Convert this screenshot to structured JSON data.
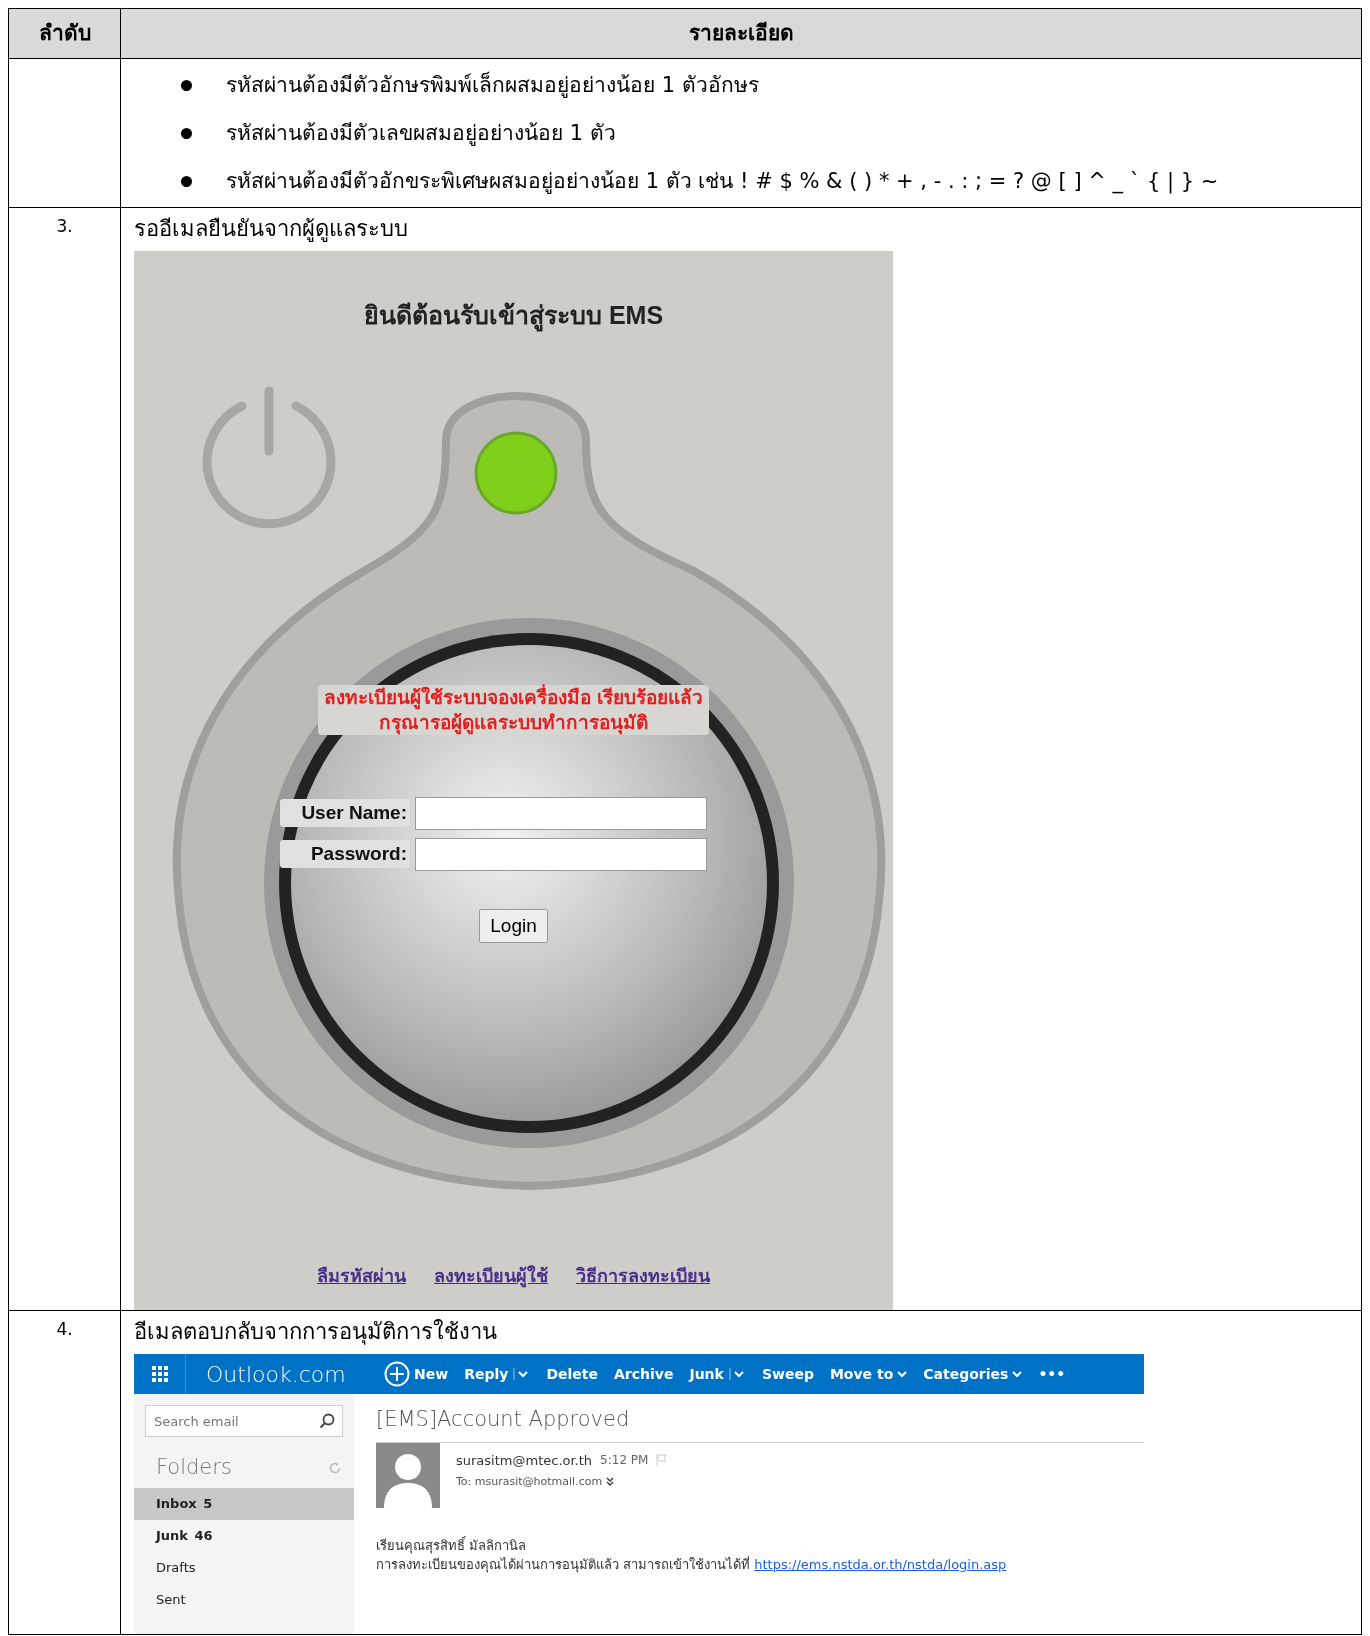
{
  "table": {
    "columns": [
      "ลำดับ",
      "รายละเอียด"
    ],
    "rows": [
      {
        "kind": "bullets",
        "bullets": [
          "รหัสผ่านต้องมีตัวอักษรพิมพ์เล็กผสมอยู่อย่างน้อย 1 ตัวอักษร",
          "รหัสผ่านต้องมีตัวเลขผสมอยู่อย่างน้อย 1 ตัว",
          "รหัสผ่านต้องมีตัวอักขระพิเศษผสมอยู่อย่างน้อย 1 ตัว เช่น ! # $ % & ( ) * + , - . : ; = ? @ [ ] ^ _ ` { | } ~"
        ]
      },
      {
        "kind": "login",
        "number": "3.",
        "title": "รออีเมลยืนยันจากผู้ดูแลระบบ",
        "screen": {
          "heading": "ยินดีต้อนรับเข้าสู่ระบบ EMS",
          "message": [
            "ลงทะเบียนผู้ใช้ระบบจองเครื่องมือ เรียบร้อยแล้ว",
            "กรุณารอผู้ดูแลระบบทำการอนุมัติ"
          ],
          "fields": [
            {
              "label": "User Name:"
            },
            {
              "label": "Password:"
            }
          ],
          "button": "Login",
          "links": [
            "ลืมรหัสผ่าน",
            "ลงทะเบียนผู้ใช้",
            "วิธีการลงทะเบียน"
          ]
        }
      },
      {
        "kind": "email",
        "number": "4.",
        "title": "อีเมลตอบกลับจากการอนุมัติการใช้งาน",
        "screen": {
          "app_name": "Outlook.com",
          "toolbar": [
            {
              "label": "New",
              "kind": "new"
            },
            {
              "label": "Reply",
              "kind": "split"
            },
            {
              "label": "Delete",
              "kind": "plain"
            },
            {
              "label": "Archive",
              "kind": "plain"
            },
            {
              "label": "Junk",
              "kind": "split"
            },
            {
              "label": "Sweep",
              "kind": "plain"
            },
            {
              "label": "Move to",
              "kind": "menu"
            },
            {
              "label": "Categories",
              "kind": "menu"
            },
            {
              "label": "•••",
              "kind": "plain"
            }
          ],
          "search": {
            "placeholder": "Search email"
          },
          "folders_heading": "Folders",
          "folders": [
            {
              "name": "Inbox",
              "count": "5",
              "selected": true
            },
            {
              "name": "Junk",
              "count": "46",
              "selected": false
            },
            {
              "name": "Drafts",
              "selected": false
            },
            {
              "name": "Sent",
              "selected": false
            }
          ],
          "message": {
            "subject": "[EMS]Account Approved",
            "from": "surasitm@mtec.or.th",
            "time": "5:12 PM",
            "to": "To: msurasit@hotmail.com",
            "greeting": "เรียนคุณสุรสิทธิ์ มัลลิกานิล",
            "body": "การลงทะเบียนของคุณได้ผ่านการอนุมัติแล้ว สามารถเข้าใช้งานได้ที่",
            "link": "https://ems.nstda.or.th/nstda/login.asp"
          }
        }
      }
    ]
  }
}
